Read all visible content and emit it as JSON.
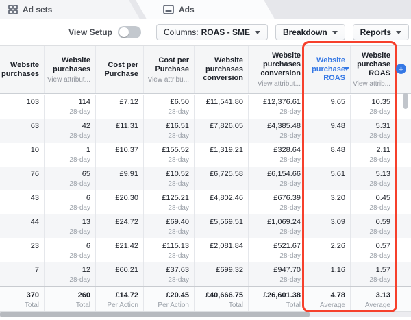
{
  "tabs": {
    "ad_sets_label": "Ad sets",
    "ads_label": "Ads"
  },
  "toolbar": {
    "view_setup_label": "View Setup",
    "view_setup_state": "off",
    "columns_prefix": "Columns:",
    "columns_value": "ROAS - SME",
    "breakdown_label": "Breakdown",
    "reports_label": "Reports"
  },
  "table": {
    "columns": [
      {
        "title": "Website purchases",
        "sub": ""
      },
      {
        "title": "Website purchases",
        "sub": "View attribut..."
      },
      {
        "title": "Cost per Purchase",
        "sub": ""
      },
      {
        "title": "Cost per Purchase",
        "sub": "View attribu..."
      },
      {
        "title": "Website purchases conversion",
        "sub": ""
      },
      {
        "title": "Website purchases conversion",
        "sub": "View attribut..."
      },
      {
        "title": "Website purchase ROAS",
        "sub": "",
        "sorted": true,
        "sort_direction": "descending"
      },
      {
        "title": "Website purchase ROAS",
        "sub": "View attrib..."
      }
    ],
    "attribution_window": "28-day",
    "attribution_columns": [
      1,
      3,
      5,
      7
    ],
    "rows": [
      [
        "103",
        "114",
        "£7.12",
        "£6.50",
        "£11,541.80",
        "£12,376.61",
        "9.65",
        "10.35"
      ],
      [
        "63",
        "42",
        "£11.31",
        "£16.51",
        "£7,826.05",
        "£4,385.48",
        "9.48",
        "5.31"
      ],
      [
        "10",
        "1",
        "£10.37",
        "£155.52",
        "£1,319.21",
        "£328.64",
        "8.48",
        "2.11"
      ],
      [
        "76",
        "65",
        "£9.91",
        "£10.52",
        "£6,725.58",
        "£6,154.66",
        "5.61",
        "5.13"
      ],
      [
        "43",
        "6",
        "£20.30",
        "£125.21",
        "£4,802.46",
        "£676.39",
        "3.20",
        "0.45"
      ],
      [
        "44",
        "13",
        "£24.72",
        "£69.40",
        "£5,569.51",
        "£1,069.24",
        "3.09",
        "0.59"
      ],
      [
        "23",
        "6",
        "£21.42",
        "£115.13",
        "£2,081.84",
        "£521.67",
        "2.26",
        "0.57"
      ],
      [
        "7",
        "12",
        "£60.21",
        "£37.63",
        "£699.32",
        "£947.70",
        "1.16",
        "1.57"
      ]
    ],
    "totals": {
      "values": [
        "370",
        "260",
        "£14.72",
        "£20.45",
        "£40,666.75",
        "£26,601.38",
        "4.78",
        "3.13"
      ],
      "labels": [
        "Total",
        "Total",
        "Per Action",
        "Per Action",
        "Total",
        "Total",
        "Average",
        "Average"
      ]
    }
  },
  "colors": {
    "accent_blue": "#3578e5",
    "highlight_red": "#f6402c"
  }
}
